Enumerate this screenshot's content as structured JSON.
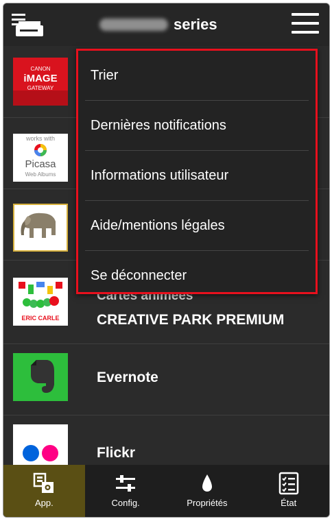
{
  "header": {
    "title_suffix": "series",
    "printer_icon": "printer-icon",
    "menu_icon": "hamburger-menu-icon"
  },
  "dropdown": {
    "items": [
      "Trier",
      "Dernières notifications",
      "Informations utilisateur",
      "Aide/mentions légales",
      "Se déconnecter"
    ]
  },
  "apps": [
    {
      "name": "",
      "thumb_text": [
        "CANON",
        "iMAGE",
        "GATEWAY"
      ]
    },
    {
      "name": "",
      "thumb_text": [
        "works with",
        "Picasa",
        "Web Albums"
      ]
    },
    {
      "name": ""
    },
    {
      "name": "CREATIVE PARK PREMIUM",
      "subname": "Cartes animées",
      "thumb_text": [
        "ERIC CARLE"
      ]
    },
    {
      "name": "Evernote"
    },
    {
      "name": "Flickr"
    }
  ],
  "bottombar": {
    "tabs": [
      {
        "label": "App.",
        "icon": "apps-icon",
        "active": true
      },
      {
        "label": "Config.",
        "icon": "sliders-icon",
        "active": false
      },
      {
        "label": "Propriétés",
        "icon": "ink-drop-icon",
        "active": false
      },
      {
        "label": "État",
        "icon": "checklist-icon",
        "active": false
      }
    ]
  },
  "colors": {
    "background": "#2b2b2b",
    "highlight_border": "#e8101d",
    "active_tab": "#5a4f14",
    "evernote_green": "#2dbe3c",
    "canon_red": "#d9131e"
  }
}
